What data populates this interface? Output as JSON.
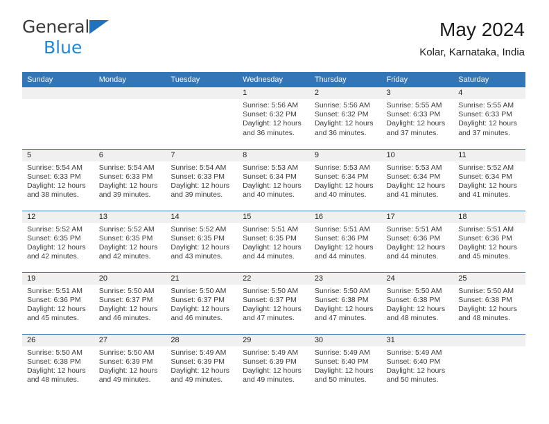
{
  "brand": {
    "line1": "General",
    "line2": "Blue",
    "triangle_color": "#1f72bd",
    "text_color": "#3b3b3b",
    "blue_color": "#1f86d8"
  },
  "header": {
    "title": "May 2024",
    "subtitle": "Kolar, Karnataka, India"
  },
  "theme": {
    "header_blue": "#3276b8",
    "daynum_band": "#f0f0f0",
    "text": "#3a3a3a"
  },
  "weekday_headers": [
    "Sunday",
    "Monday",
    "Tuesday",
    "Wednesday",
    "Thursday",
    "Friday",
    "Saturday"
  ],
  "weeks": [
    [
      {
        "day": "",
        "empty": true
      },
      {
        "day": "",
        "empty": true
      },
      {
        "day": "",
        "empty": true
      },
      {
        "day": "1",
        "sunrise": "Sunrise: 5:56 AM",
        "sunset": "Sunset: 6:32 PM",
        "daylight": "Daylight: 12 hours and 36 minutes."
      },
      {
        "day": "2",
        "sunrise": "Sunrise: 5:56 AM",
        "sunset": "Sunset: 6:32 PM",
        "daylight": "Daylight: 12 hours and 36 minutes."
      },
      {
        "day": "3",
        "sunrise": "Sunrise: 5:55 AM",
        "sunset": "Sunset: 6:33 PM",
        "daylight": "Daylight: 12 hours and 37 minutes."
      },
      {
        "day": "4",
        "sunrise": "Sunrise: 5:55 AM",
        "sunset": "Sunset: 6:33 PM",
        "daylight": "Daylight: 12 hours and 37 minutes."
      }
    ],
    [
      {
        "day": "5",
        "sunrise": "Sunrise: 5:54 AM",
        "sunset": "Sunset: 6:33 PM",
        "daylight": "Daylight: 12 hours and 38 minutes."
      },
      {
        "day": "6",
        "sunrise": "Sunrise: 5:54 AM",
        "sunset": "Sunset: 6:33 PM",
        "daylight": "Daylight: 12 hours and 39 minutes."
      },
      {
        "day": "7",
        "sunrise": "Sunrise: 5:54 AM",
        "sunset": "Sunset: 6:33 PM",
        "daylight": "Daylight: 12 hours and 39 minutes."
      },
      {
        "day": "8",
        "sunrise": "Sunrise: 5:53 AM",
        "sunset": "Sunset: 6:34 PM",
        "daylight": "Daylight: 12 hours and 40 minutes."
      },
      {
        "day": "9",
        "sunrise": "Sunrise: 5:53 AM",
        "sunset": "Sunset: 6:34 PM",
        "daylight": "Daylight: 12 hours and 40 minutes."
      },
      {
        "day": "10",
        "sunrise": "Sunrise: 5:53 AM",
        "sunset": "Sunset: 6:34 PM",
        "daylight": "Daylight: 12 hours and 41 minutes."
      },
      {
        "day": "11",
        "sunrise": "Sunrise: 5:52 AM",
        "sunset": "Sunset: 6:34 PM",
        "daylight": "Daylight: 12 hours and 41 minutes."
      }
    ],
    [
      {
        "day": "12",
        "sunrise": "Sunrise: 5:52 AM",
        "sunset": "Sunset: 6:35 PM",
        "daylight": "Daylight: 12 hours and 42 minutes."
      },
      {
        "day": "13",
        "sunrise": "Sunrise: 5:52 AM",
        "sunset": "Sunset: 6:35 PM",
        "daylight": "Daylight: 12 hours and 42 minutes."
      },
      {
        "day": "14",
        "sunrise": "Sunrise: 5:52 AM",
        "sunset": "Sunset: 6:35 PM",
        "daylight": "Daylight: 12 hours and 43 minutes."
      },
      {
        "day": "15",
        "sunrise": "Sunrise: 5:51 AM",
        "sunset": "Sunset: 6:35 PM",
        "daylight": "Daylight: 12 hours and 44 minutes."
      },
      {
        "day": "16",
        "sunrise": "Sunrise: 5:51 AM",
        "sunset": "Sunset: 6:36 PM",
        "daylight": "Daylight: 12 hours and 44 minutes."
      },
      {
        "day": "17",
        "sunrise": "Sunrise: 5:51 AM",
        "sunset": "Sunset: 6:36 PM",
        "daylight": "Daylight: 12 hours and 44 minutes."
      },
      {
        "day": "18",
        "sunrise": "Sunrise: 5:51 AM",
        "sunset": "Sunset: 6:36 PM",
        "daylight": "Daylight: 12 hours and 45 minutes."
      }
    ],
    [
      {
        "day": "19",
        "sunrise": "Sunrise: 5:51 AM",
        "sunset": "Sunset: 6:36 PM",
        "daylight": "Daylight: 12 hours and 45 minutes."
      },
      {
        "day": "20",
        "sunrise": "Sunrise: 5:50 AM",
        "sunset": "Sunset: 6:37 PM",
        "daylight": "Daylight: 12 hours and 46 minutes."
      },
      {
        "day": "21",
        "sunrise": "Sunrise: 5:50 AM",
        "sunset": "Sunset: 6:37 PM",
        "daylight": "Daylight: 12 hours and 46 minutes."
      },
      {
        "day": "22",
        "sunrise": "Sunrise: 5:50 AM",
        "sunset": "Sunset: 6:37 PM",
        "daylight": "Daylight: 12 hours and 47 minutes."
      },
      {
        "day": "23",
        "sunrise": "Sunrise: 5:50 AM",
        "sunset": "Sunset: 6:38 PM",
        "daylight": "Daylight: 12 hours and 47 minutes."
      },
      {
        "day": "24",
        "sunrise": "Sunrise: 5:50 AM",
        "sunset": "Sunset: 6:38 PM",
        "daylight": "Daylight: 12 hours and 48 minutes."
      },
      {
        "day": "25",
        "sunrise": "Sunrise: 5:50 AM",
        "sunset": "Sunset: 6:38 PM",
        "daylight": "Daylight: 12 hours and 48 minutes."
      }
    ],
    [
      {
        "day": "26",
        "sunrise": "Sunrise: 5:50 AM",
        "sunset": "Sunset: 6:38 PM",
        "daylight": "Daylight: 12 hours and 48 minutes."
      },
      {
        "day": "27",
        "sunrise": "Sunrise: 5:50 AM",
        "sunset": "Sunset: 6:39 PM",
        "daylight": "Daylight: 12 hours and 49 minutes."
      },
      {
        "day": "28",
        "sunrise": "Sunrise: 5:49 AM",
        "sunset": "Sunset: 6:39 PM",
        "daylight": "Daylight: 12 hours and 49 minutes."
      },
      {
        "day": "29",
        "sunrise": "Sunrise: 5:49 AM",
        "sunset": "Sunset: 6:39 PM",
        "daylight": "Daylight: 12 hours and 49 minutes."
      },
      {
        "day": "30",
        "sunrise": "Sunrise: 5:49 AM",
        "sunset": "Sunset: 6:40 PM",
        "daylight": "Daylight: 12 hours and 50 minutes."
      },
      {
        "day": "31",
        "sunrise": "Sunrise: 5:49 AM",
        "sunset": "Sunset: 6:40 PM",
        "daylight": "Daylight: 12 hours and 50 minutes."
      },
      {
        "day": "",
        "empty": true
      }
    ]
  ]
}
